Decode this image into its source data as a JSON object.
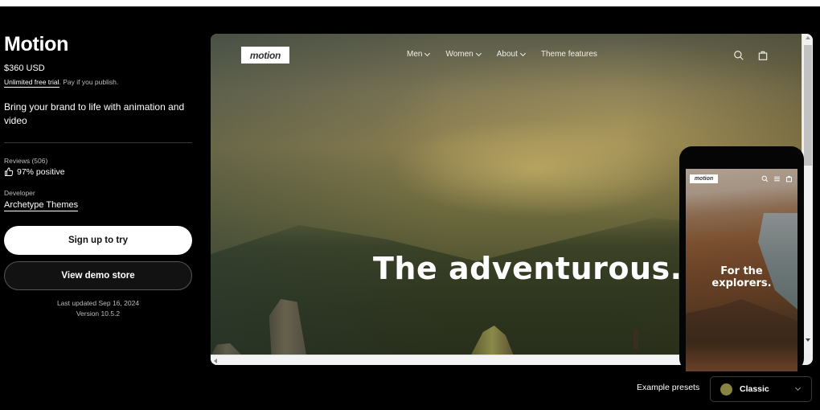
{
  "theme": {
    "title": "Motion",
    "price": "$360 USD",
    "trial_highlight": "Unlimited free trial",
    "trial_rest": ". Pay if you publish.",
    "tagline": "Bring your brand to life with animation and video",
    "reviews_label": "Reviews (506)",
    "reviews_value": "97% positive",
    "developer_label": "Developer",
    "developer_name": "Archetype Themes",
    "primary_button": "Sign up to try",
    "secondary_button": "View demo store",
    "last_updated": "Last updated Sep 16, 2024",
    "version": "Version 10.5.2"
  },
  "preview": {
    "logo": "motion",
    "nav": [
      {
        "label": "Men",
        "has_dropdown": true
      },
      {
        "label": "Women",
        "has_dropdown": true
      },
      {
        "label": "About",
        "has_dropdown": true
      },
      {
        "label": "Theme features",
        "has_dropdown": false
      }
    ],
    "icons": [
      "search-icon",
      "bag-icon"
    ],
    "headline": "The adventurous."
  },
  "mobile_preview": {
    "logo": "motion",
    "icons": [
      "search-icon",
      "menu-icon",
      "bag-icon"
    ],
    "headline_line1": "For the",
    "headline_line2": "explorers."
  },
  "presets": {
    "label": "Example presets",
    "selected": "Classic",
    "swatch_color": "#8a8442"
  }
}
